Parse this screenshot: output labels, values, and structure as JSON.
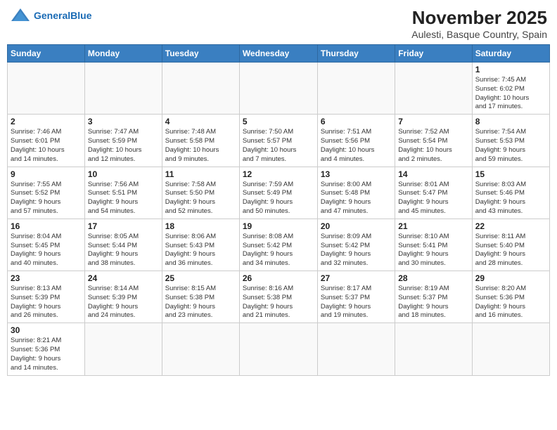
{
  "header": {
    "logo_general": "General",
    "logo_blue": "Blue",
    "title": "November 2025",
    "subtitle": "Aulesti, Basque Country, Spain"
  },
  "days_of_week": [
    "Sunday",
    "Monday",
    "Tuesday",
    "Wednesday",
    "Thursday",
    "Friday",
    "Saturday"
  ],
  "weeks": [
    [
      {
        "day": "",
        "info": ""
      },
      {
        "day": "",
        "info": ""
      },
      {
        "day": "",
        "info": ""
      },
      {
        "day": "",
        "info": ""
      },
      {
        "day": "",
        "info": ""
      },
      {
        "day": "",
        "info": ""
      },
      {
        "day": "1",
        "info": "Sunrise: 7:45 AM\nSunset: 6:02 PM\nDaylight: 10 hours\nand 17 minutes."
      }
    ],
    [
      {
        "day": "2",
        "info": "Sunrise: 7:46 AM\nSunset: 6:01 PM\nDaylight: 10 hours\nand 14 minutes."
      },
      {
        "day": "3",
        "info": "Sunrise: 7:47 AM\nSunset: 5:59 PM\nDaylight: 10 hours\nand 12 minutes."
      },
      {
        "day": "4",
        "info": "Sunrise: 7:48 AM\nSunset: 5:58 PM\nDaylight: 10 hours\nand 9 minutes."
      },
      {
        "day": "5",
        "info": "Sunrise: 7:50 AM\nSunset: 5:57 PM\nDaylight: 10 hours\nand 7 minutes."
      },
      {
        "day": "6",
        "info": "Sunrise: 7:51 AM\nSunset: 5:56 PM\nDaylight: 10 hours\nand 4 minutes."
      },
      {
        "day": "7",
        "info": "Sunrise: 7:52 AM\nSunset: 5:54 PM\nDaylight: 10 hours\nand 2 minutes."
      },
      {
        "day": "8",
        "info": "Sunrise: 7:54 AM\nSunset: 5:53 PM\nDaylight: 9 hours\nand 59 minutes."
      }
    ],
    [
      {
        "day": "9",
        "info": "Sunrise: 7:55 AM\nSunset: 5:52 PM\nDaylight: 9 hours\nand 57 minutes."
      },
      {
        "day": "10",
        "info": "Sunrise: 7:56 AM\nSunset: 5:51 PM\nDaylight: 9 hours\nand 54 minutes."
      },
      {
        "day": "11",
        "info": "Sunrise: 7:58 AM\nSunset: 5:50 PM\nDaylight: 9 hours\nand 52 minutes."
      },
      {
        "day": "12",
        "info": "Sunrise: 7:59 AM\nSunset: 5:49 PM\nDaylight: 9 hours\nand 50 minutes."
      },
      {
        "day": "13",
        "info": "Sunrise: 8:00 AM\nSunset: 5:48 PM\nDaylight: 9 hours\nand 47 minutes."
      },
      {
        "day": "14",
        "info": "Sunrise: 8:01 AM\nSunset: 5:47 PM\nDaylight: 9 hours\nand 45 minutes."
      },
      {
        "day": "15",
        "info": "Sunrise: 8:03 AM\nSunset: 5:46 PM\nDaylight: 9 hours\nand 43 minutes."
      }
    ],
    [
      {
        "day": "16",
        "info": "Sunrise: 8:04 AM\nSunset: 5:45 PM\nDaylight: 9 hours\nand 40 minutes."
      },
      {
        "day": "17",
        "info": "Sunrise: 8:05 AM\nSunset: 5:44 PM\nDaylight: 9 hours\nand 38 minutes."
      },
      {
        "day": "18",
        "info": "Sunrise: 8:06 AM\nSunset: 5:43 PM\nDaylight: 9 hours\nand 36 minutes."
      },
      {
        "day": "19",
        "info": "Sunrise: 8:08 AM\nSunset: 5:42 PM\nDaylight: 9 hours\nand 34 minutes."
      },
      {
        "day": "20",
        "info": "Sunrise: 8:09 AM\nSunset: 5:42 PM\nDaylight: 9 hours\nand 32 minutes."
      },
      {
        "day": "21",
        "info": "Sunrise: 8:10 AM\nSunset: 5:41 PM\nDaylight: 9 hours\nand 30 minutes."
      },
      {
        "day": "22",
        "info": "Sunrise: 8:11 AM\nSunset: 5:40 PM\nDaylight: 9 hours\nand 28 minutes."
      }
    ],
    [
      {
        "day": "23",
        "info": "Sunrise: 8:13 AM\nSunset: 5:39 PM\nDaylight: 9 hours\nand 26 minutes."
      },
      {
        "day": "24",
        "info": "Sunrise: 8:14 AM\nSunset: 5:39 PM\nDaylight: 9 hours\nand 24 minutes."
      },
      {
        "day": "25",
        "info": "Sunrise: 8:15 AM\nSunset: 5:38 PM\nDaylight: 9 hours\nand 23 minutes."
      },
      {
        "day": "26",
        "info": "Sunrise: 8:16 AM\nSunset: 5:38 PM\nDaylight: 9 hours\nand 21 minutes."
      },
      {
        "day": "27",
        "info": "Sunrise: 8:17 AM\nSunset: 5:37 PM\nDaylight: 9 hours\nand 19 minutes."
      },
      {
        "day": "28",
        "info": "Sunrise: 8:19 AM\nSunset: 5:37 PM\nDaylight: 9 hours\nand 18 minutes."
      },
      {
        "day": "29",
        "info": "Sunrise: 8:20 AM\nSunset: 5:36 PM\nDaylight: 9 hours\nand 16 minutes."
      }
    ],
    [
      {
        "day": "30",
        "info": "Sunrise: 8:21 AM\nSunset: 5:36 PM\nDaylight: 9 hours\nand 14 minutes."
      },
      {
        "day": "",
        "info": ""
      },
      {
        "day": "",
        "info": ""
      },
      {
        "day": "",
        "info": ""
      },
      {
        "day": "",
        "info": ""
      },
      {
        "day": "",
        "info": ""
      },
      {
        "day": "",
        "info": ""
      }
    ]
  ]
}
